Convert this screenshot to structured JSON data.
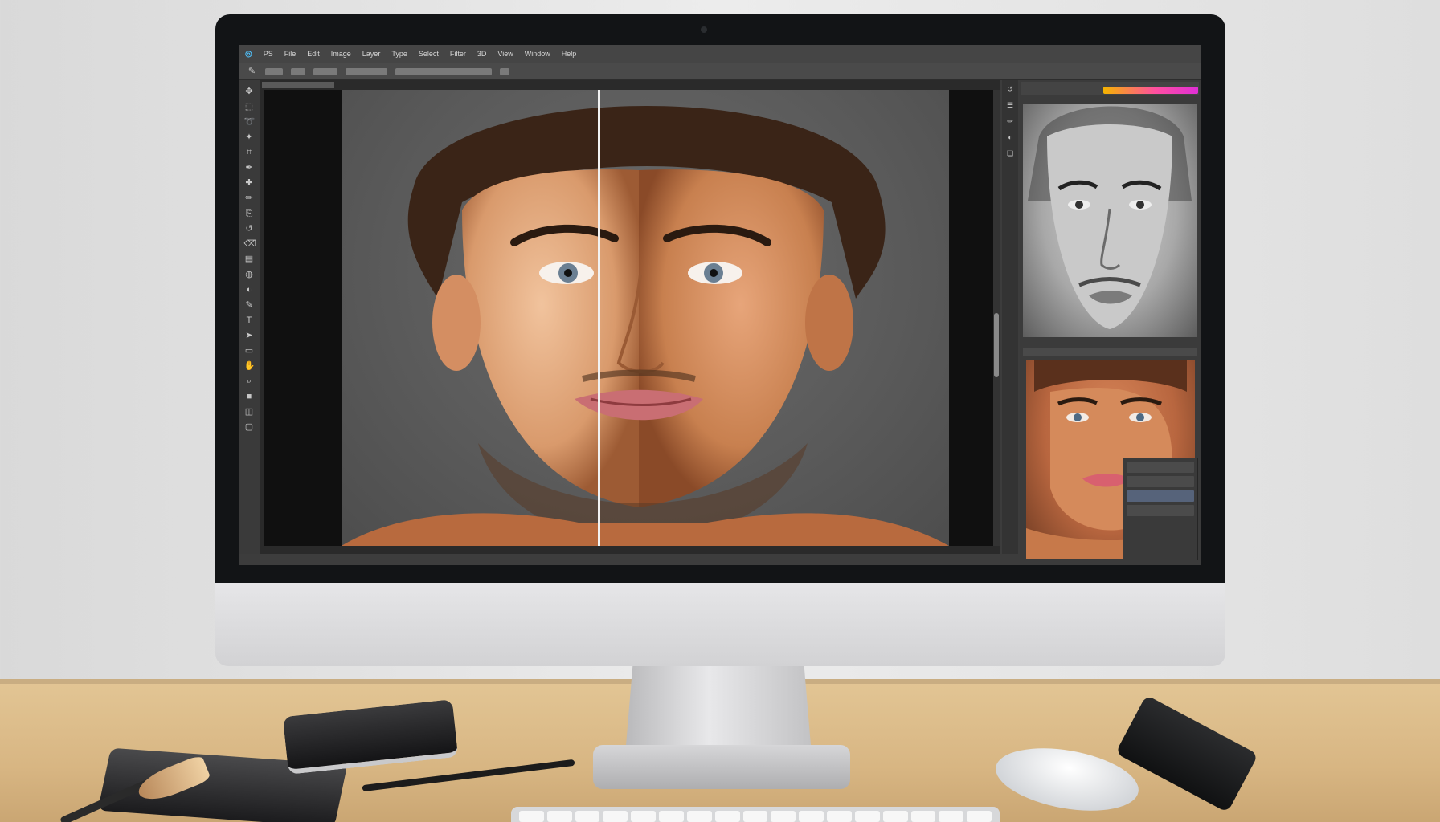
{
  "app": {
    "menu": [
      "PS",
      "File",
      "Edit",
      "Image",
      "Layer",
      "Type",
      "Select",
      "Filter",
      "3D",
      "View",
      "Window",
      "Help"
    ],
    "status_text": "",
    "accent_color": "#4fc3ff",
    "panel_gradient_colors": [
      "#f5b400",
      "#ff4fa0",
      "#e02fd6"
    ]
  },
  "toolbar": {
    "tools": [
      "move-icon",
      "marquee-icon",
      "lasso-icon",
      "quick-select-icon",
      "crop-icon",
      "eyedropper-icon",
      "healing-brush-icon",
      "brush-icon",
      "clone-stamp-icon",
      "history-brush-icon",
      "eraser-icon",
      "gradient-icon",
      "blur-icon",
      "dodge-icon",
      "pen-icon",
      "type-icon",
      "path-select-icon",
      "shape-icon",
      "hand-icon",
      "zoom-icon",
      "foreground-color-icon",
      "quick-mask-icon",
      "screen-mode-icon"
    ]
  },
  "panels": {
    "side_icons": [
      "history-icon",
      "properties-icon",
      "brushes-icon",
      "adjustments-icon",
      "layers-icon"
    ],
    "layers": [
      "layer-1",
      "layer-2",
      "layer-3",
      "layer-4"
    ]
  }
}
